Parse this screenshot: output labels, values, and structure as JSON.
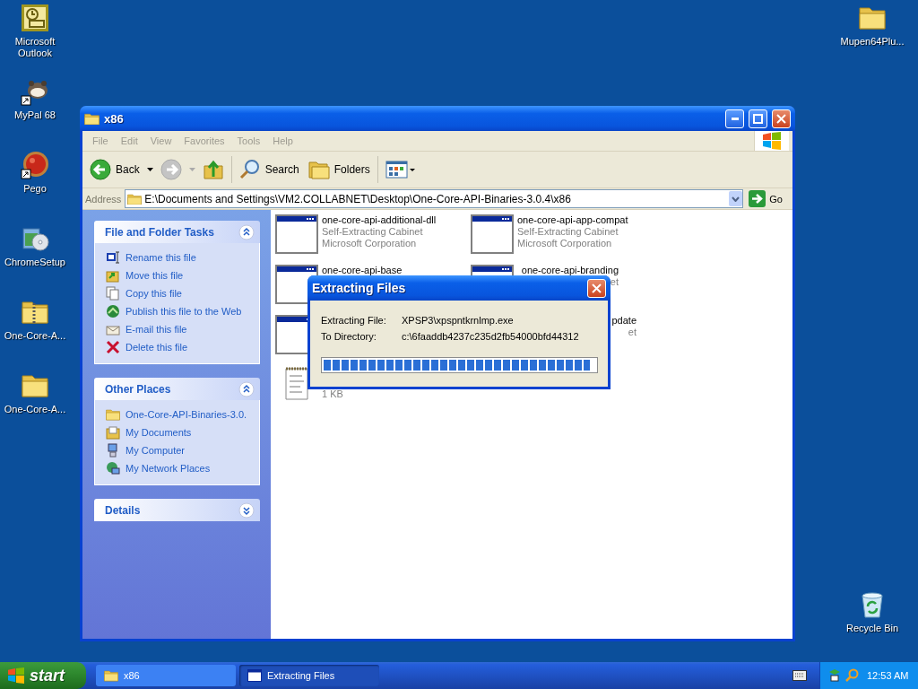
{
  "desktop_icons": [
    {
      "label": "Microsoft Outlook",
      "kind": "outlook"
    },
    {
      "label": "MyPal 68",
      "kind": "animal"
    },
    {
      "label": "Pego",
      "kind": "ball"
    },
    {
      "label": "ChromeSetup",
      "kind": "installer"
    },
    {
      "label": "One-Core-A...",
      "kind": "zip"
    },
    {
      "label": "One-Core-A...",
      "kind": "folder"
    },
    {
      "label": "Mupen64Plu...",
      "kind": "folder"
    },
    {
      "label": "Recycle Bin",
      "kind": "recycle"
    }
  ],
  "explorer": {
    "title": "x86",
    "menu": [
      "File",
      "Edit",
      "View",
      "Favorites",
      "Tools",
      "Help"
    ],
    "toolbar": [
      {
        "kind": "back",
        "label": "Back",
        "disabled": false
      },
      {
        "kind": "forward",
        "disabled": true
      },
      {
        "kind": "up"
      },
      {
        "kind": "search",
        "label": "Search"
      },
      {
        "kind": "folders",
        "label": "Folders"
      },
      {
        "kind": "views"
      }
    ],
    "address": {
      "label": "Address",
      "value": "E:\\Documents and Settings\\VM2.COLLABNET\\Desktop\\One-Core-API-Binaries-3.0.4\\x86",
      "go": "Go"
    },
    "task_panels": [
      {
        "title": "File and Folder Tasks",
        "expanded": true,
        "items": [
          {
            "label": "Rename this file",
            "kind": "rename"
          },
          {
            "label": "Move this file",
            "kind": "move"
          },
          {
            "label": "Copy this file",
            "kind": "copy"
          },
          {
            "label": "Publish this file to the Web",
            "kind": "publish"
          },
          {
            "label": "E-mail this file",
            "kind": "email"
          },
          {
            "label": "Delete this file",
            "kind": "delete"
          }
        ]
      },
      {
        "title": "Other Places",
        "expanded": true,
        "items": [
          {
            "label": "One-Core-API-Binaries-3.0.",
            "kind": "folder"
          },
          {
            "label": "My Documents",
            "kind": "documents"
          },
          {
            "label": "My Computer",
            "kind": "computer"
          },
          {
            "label": "My Network Places",
            "kind": "network"
          }
        ]
      },
      {
        "title": "Details",
        "expanded": false
      }
    ],
    "files": [
      {
        "kind": "cabinet",
        "name": "one-core-api-additional-dll",
        "type": "Self-Extracting Cabinet",
        "company": "Microsoft Corporation"
      },
      {
        "kind": "cabinet",
        "name": "one-core-api-app-compat",
        "type": "Self-Extracting Cabinet",
        "company": "Microsoft Corporation"
      },
      {
        "kind": "cabinet",
        "name": "one-core-api-base"
      },
      {
        "kind": "cabinet",
        "covered": true,
        "name": "one-core-api-branding",
        "type": "et"
      },
      {
        "kind": "cabinet"
      },
      {
        "covered": true,
        "name": "pdate",
        "type": "et"
      },
      {
        "kind": "text",
        "size": "1 KB"
      }
    ]
  },
  "dialog": {
    "title": "Extracting Files",
    "fields": [
      {
        "label": "Extracting File:",
        "value": "XPSP3\\xpspntkrnlmp.exe"
      },
      {
        "label": "To Directory:",
        "value": "c:\\6faaddb4237c235d2fb54000bfd44312"
      }
    ],
    "progress": {
      "level": 0.98
    }
  },
  "taskbar": {
    "start": "start",
    "tasks": [
      {
        "label": "x86",
        "kind": "folder",
        "selected": false
      },
      {
        "label": "Extracting Files",
        "kind": "window",
        "selected": true
      }
    ],
    "clock": "12:53 AM"
  }
}
